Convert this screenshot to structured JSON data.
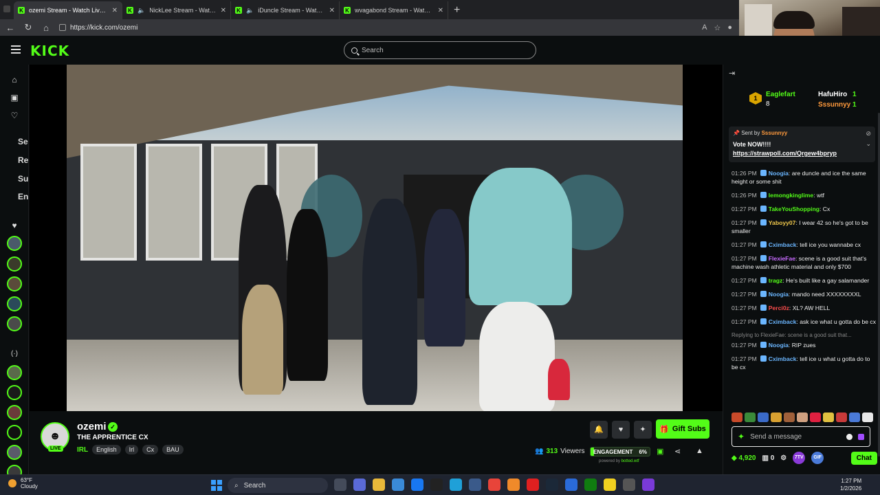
{
  "browser": {
    "tabs": [
      {
        "title": "ozemi Stream - Watch Live on Kick",
        "active": true,
        "muted": false
      },
      {
        "title": "NickLee Stream - Watch Live on Kick",
        "active": false,
        "muted": true
      },
      {
        "title": "iDuncle Stream - Watch Live on Kick",
        "active": false,
        "muted": true
      },
      {
        "title": "wvagabond Stream - Watch Live on Kick",
        "active": false,
        "muted": false
      }
    ],
    "url": "https://kick.com/ozemi"
  },
  "header": {
    "logo": "KICK",
    "search_placeholder": "Search"
  },
  "sidebar": {
    "section_letters": [
      "Se",
      "Re",
      "Su",
      "En"
    ],
    "following_count": 5,
    "recommended_count": 6
  },
  "stream": {
    "streamer": "ozemi",
    "live_label": "LIVE",
    "title": "THE APPRENTICE CX",
    "category": "IRL",
    "tags": [
      "English",
      "Irl",
      "Cx",
      "BAU"
    ],
    "viewers": "313",
    "viewers_label": "Viewers",
    "engagement_label": "ENGAGEMENT",
    "engagement_value": "6%",
    "engagement_fraction": 0.06,
    "powered_by": "powered by",
    "powered_by_brand": "botted.wtf",
    "gift_subs_label": "Gift Subs"
  },
  "chat": {
    "leaderboard": {
      "first": {
        "name": "Eaglefart",
        "rank": "1",
        "count": "8"
      },
      "second": {
        "name": "HafuHiro",
        "count": "1"
      },
      "third": {
        "name": "Sssunnyy",
        "count": "1"
      }
    },
    "pinned": {
      "sent_by_label": "Sent by",
      "sender": "Sssunnyy",
      "text": "Vote NOW!!!!",
      "link": "https://strawpoll.com/Qrgew4bpryp"
    },
    "messages": [
      {
        "time": "01:26 PM",
        "user": "Noogia",
        "color": "#6bb6ff",
        "text": "are duncle and ice the same height or some shit"
      },
      {
        "time": "01:26 PM",
        "user": "lemongkinglime",
        "color": "#53fc18",
        "text": "wtf"
      },
      {
        "time": "01:27 PM",
        "user": "TakeYouShopping",
        "color": "#53fc18",
        "text": "Cx"
      },
      {
        "time": "01:27 PM",
        "user": "Yaboyy07",
        "color": "#f2c94c",
        "text": "I wear 42 so he's got to be smaller"
      },
      {
        "time": "01:27 PM",
        "user": "Cximback",
        "color": "#6bb6ff",
        "text": "tell ice you wannabe cx"
      },
      {
        "time": "01:27 PM",
        "user": "FlexieFae",
        "color": "#c86bff",
        "text": "scene is a good suit that's machine wash athletic material and only $700"
      },
      {
        "time": "01:27 PM",
        "user": "tragz",
        "color": "#53fc18",
        "text": "He's built like a gay salamander"
      },
      {
        "time": "01:27 PM",
        "user": "Noogia",
        "color": "#6bb6ff",
        "text": "mando need XXXXXXXXL"
      },
      {
        "time": "01:27 PM",
        "user": "Perci0z",
        "color": "#ff4d4d",
        "text": "XL? AW HELL"
      },
      {
        "time": "01:27 PM",
        "user": "Cximback",
        "color": "#6bb6ff",
        "text": "ask ice what u gotta do be cx"
      }
    ],
    "reply_context": "Replying to FlexieFae: scene is a good suit that...",
    "messages_after": [
      {
        "time": "01:27 PM",
        "user": "Noogia",
        "color": "#6bb6ff",
        "text": "RIP zues"
      },
      {
        "time": "01:27 PM",
        "user": "Cximback",
        "color": "#6bb6ff",
        "text": "tell ice u what u gotta do to be cx"
      }
    ],
    "input_placeholder": "Send a message",
    "points": "4,920",
    "gift_count": "0",
    "seven_tv_label": "7TV",
    "gif_label": "GIF",
    "chat_button": "Chat"
  },
  "taskbar": {
    "temperature": "63°F",
    "condition": "Cloudy",
    "search_label": "Search",
    "time": "1:27 PM",
    "date": "1/2/2026"
  },
  "colors": {
    "kick_green": "#53fc18",
    "background": "#0b0e0f"
  }
}
